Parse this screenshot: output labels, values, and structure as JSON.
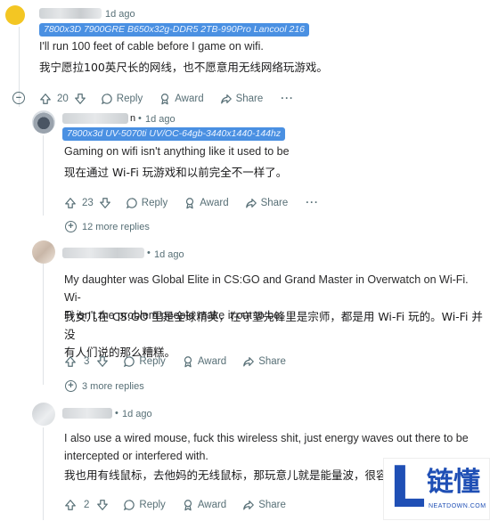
{
  "comments": [
    {
      "time": "1d ago",
      "flair": "7800x3D 7900GRE B650x32g-DDR5 2TB-990Pro Lancool 216",
      "body_en": "I'll run 100 feet of cable before I game on wifi.",
      "body_zh": "我宁愿拉100英尺长的网线，也不愿意用无线网络玩游戏。",
      "votes": "20",
      "reply_label": "Reply",
      "award_label": "Award",
      "share_label": "Share",
      "more_label": "···"
    },
    {
      "username_suffix": "n",
      "time": "1d ago",
      "flair": "7800x3d UV-5070ti UV/OC-64gb-3440x1440-144hz",
      "body_en": "Gaming on wifi isn't anything like it used to be",
      "body_zh": "现在通过 Wi-Fi 玩游戏和以前完全不一样了。",
      "votes": "23",
      "reply_label": "Reply",
      "award_label": "Award",
      "share_label": "Share",
      "more_label": "···",
      "more_replies": "12 more replies"
    },
    {
      "time": "1d ago",
      "body_en_1": "My daughter was Global Elite in CS:GO and Grand Master in Overwatch on Wi-Fi. Wi-",
      "body_en_2": "Fi isn't the problem people make it out to be.",
      "body_zh_1": "我女儿在 CS:GO 里是全球精英，在守望先锋里是宗师，都是用 Wi-Fi 玩的。Wi-Fi 并没",
      "body_zh_2": "有人们说的那么糟糕。",
      "votes": "3",
      "reply_label": "Reply",
      "award_label": "Award",
      "share_label": "Share",
      "more_replies": "3 more replies"
    },
    {
      "time": "1d ago",
      "body_en_1": "I also use a wired mouse, fuck this wireless shit, just energy waves out there to be",
      "body_en_2": "intercepted or interfered with.",
      "body_zh_1": "我也用有线鼠标，去他妈的无线鼠标，那玩意儿就是能量波，很容易",
      "votes": "2",
      "reply_label": "Reply",
      "award_label": "Award",
      "share_label": "Share"
    }
  ],
  "watermark": {
    "brand": "链懂",
    "url": "NEATDOWN.COM",
    "letter": "L"
  },
  "colors": {
    "flair_bg": "#4a90e2",
    "text_muted": "#576f76",
    "watermark_blue": "#1f4fb5"
  },
  "icons": [
    "collapse-icon",
    "upvote-icon",
    "downvote-icon",
    "reply-icon",
    "award-icon",
    "share-icon",
    "expand-icon"
  ]
}
